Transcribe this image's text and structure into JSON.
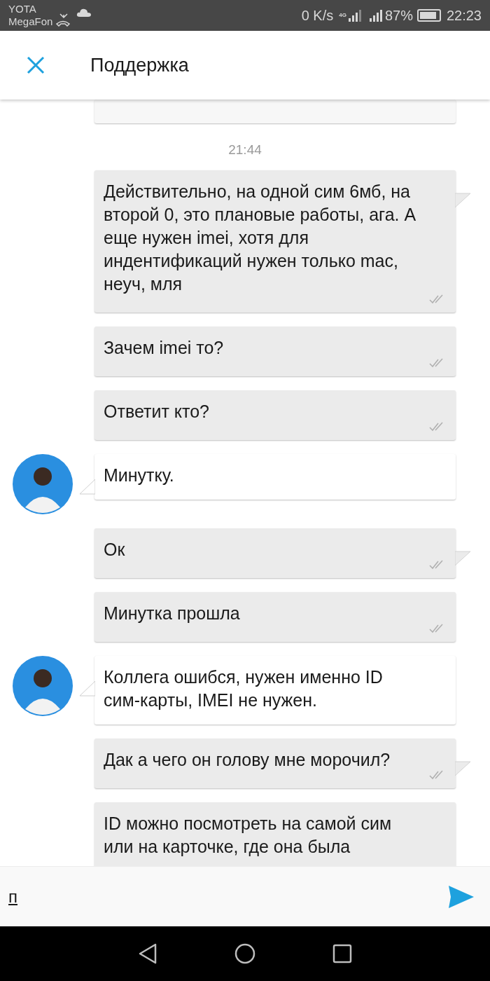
{
  "status_bar": {
    "carriers": [
      "YOTA",
      "MegaFon"
    ],
    "speed": "0 K/s",
    "network": "4G",
    "battery_percent": "87%",
    "time": "22:23"
  },
  "header": {
    "title": "Поддержка"
  },
  "chat": {
    "timestamp": "21:44",
    "messages": [
      {
        "kind": "outgoing",
        "text": "Действительно, на одной сим 6мб, на второй 0, это плановые работы, ага. А еще нужен imei, хотя для индентификаций нужен только mac, неуч, мля",
        "tail": true,
        "read": true
      },
      {
        "kind": "outgoing",
        "text": "Зачем imei то?",
        "tail": false,
        "read": true
      },
      {
        "kind": "outgoing",
        "text": "Ответит кто?",
        "tail": false,
        "read": true
      },
      {
        "kind": "incoming",
        "text": "Минутку.",
        "tail": true,
        "read": false
      },
      {
        "kind": "outgoing",
        "text": "Ок",
        "tail": true,
        "read": true
      },
      {
        "kind": "outgoing",
        "text": "Минутка прошла",
        "tail": false,
        "read": true
      },
      {
        "kind": "incoming",
        "text": "Коллега ошибся, нужен именно ID сим-карты, IMEI не нужен.",
        "tail": true,
        "read": false
      },
      {
        "kind": "outgoing",
        "text": "Дак а чего он голову мне морочил?",
        "tail": true,
        "read": true
      },
      {
        "kind": "outgoing",
        "text": "ID можно посмотреть на самой сим или на карточке, где она была",
        "tail": false,
        "read": false
      }
    ]
  },
  "composer": {
    "value": "п"
  }
}
